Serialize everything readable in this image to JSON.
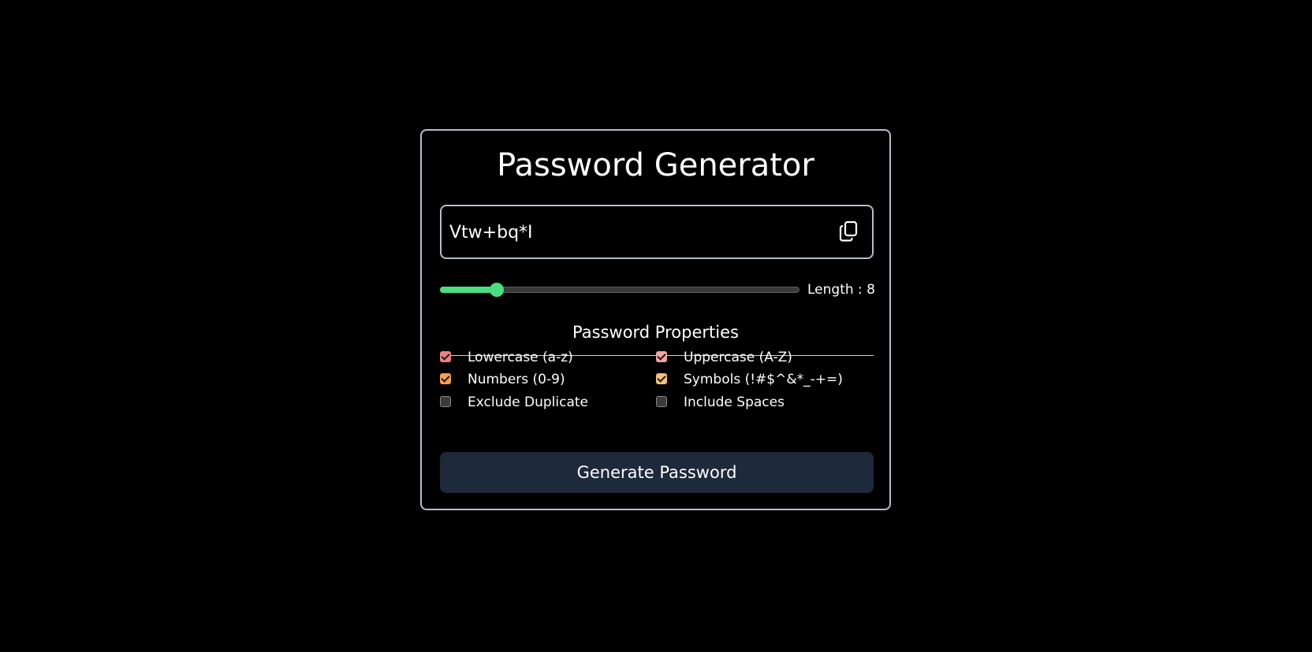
{
  "title": "Password Generator",
  "password": {
    "value": "Vtw+bq*I",
    "copy_icon": "copy-icon"
  },
  "length": {
    "label": "Length : 8",
    "value": 8,
    "min": 1,
    "max": 50,
    "fill_color": "#4ade80"
  },
  "properties": {
    "title": "Password Properties",
    "options": [
      {
        "label": "Lowercase (a-z)",
        "checked": true,
        "color": "#f08080"
      },
      {
        "label": "Uppercase (A-Z)",
        "checked": true,
        "color": "#f4a3a3"
      },
      {
        "label": "Numbers (0-9)",
        "checked": true,
        "color": "#f5a04a"
      },
      {
        "label": "Symbols (!#$^&*_-+=)",
        "checked": true,
        "color": "#f7c07a"
      },
      {
        "label": "Exclude Duplicate",
        "checked": false,
        "color": "#3b3b3b"
      },
      {
        "label": "Include Spaces",
        "checked": false,
        "color": "#3b3b3b"
      }
    ]
  },
  "generate_button": {
    "label": "Generate Password",
    "color": "#1e293b"
  }
}
